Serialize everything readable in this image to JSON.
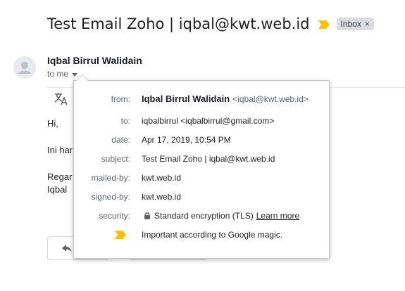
{
  "email": {
    "subject": "Test Email Zoho | iqbal@kwt.web.id",
    "label_chip": "Inbox",
    "label_chip_close": "×",
    "sender_name": "Iqbal Birrul Walidain",
    "to_me": "to me",
    "body_lines": [
      "Hi,",
      "Ini har",
      "Regar",
      "Iqbal"
    ]
  },
  "details_popup": {
    "from_label": "from:",
    "from_name": "Iqbal Birrul Walidain",
    "from_address": "<iqbal@kwt.web.id>",
    "to_label": "to:",
    "to_value": "iqbalbirrul <iqbalbirrul@gmail.com>",
    "date_label": "date:",
    "date_value": "Apr 17, 2019, 10:54 PM",
    "subject_label": "subject:",
    "subject_value": "Test Email Zoho | iqbal@kwt.web.id",
    "mailed_by_label": "mailed-by:",
    "mailed_by_value": "kwt.web.id",
    "signed_by_label": "signed-by:",
    "signed_by_value": "kwt.web.id",
    "security_label": "security:",
    "security_value": "Standard encryption (TLS)",
    "learn_more": "Learn more",
    "importance_value": "Important according to Google magic."
  },
  "icons": {
    "important_marker": "important-marker-icon",
    "avatar": "avatar-icon",
    "translate": "translate-icon",
    "reply": "reply-icon",
    "lock": "lock-icon",
    "caret": "chevron-down-icon"
  },
  "colors": {
    "important_marker": "#f4c20d",
    "chip_background": "#dadce0",
    "text_primary": "#202124",
    "text_secondary": "#5f6368",
    "popup_border": "#c6c6c6"
  }
}
